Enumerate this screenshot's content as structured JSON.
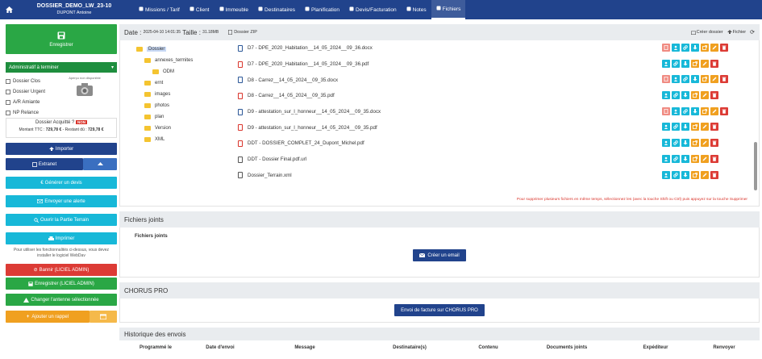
{
  "header": {
    "title": "DOSSIER_DEMO_LW_23-10",
    "subtitle": "DUPONT Antoine",
    "nav": [
      {
        "label": "Missions / Tarif",
        "icon": "grid-icon"
      },
      {
        "label": "Client",
        "icon": "user-icon"
      },
      {
        "label": "Immeuble",
        "icon": "home-icon"
      },
      {
        "label": "Destinataires",
        "icon": "users-icon"
      },
      {
        "label": "Planification",
        "icon": "calendar-icon"
      },
      {
        "label": "Devis/Facturation",
        "icon": "invoice-icon"
      },
      {
        "label": "Notes",
        "icon": "edit-icon"
      },
      {
        "label": "Fichiers",
        "icon": "file-icon"
      }
    ]
  },
  "left": {
    "save_label": "Enregistrer",
    "status_select": "Administratif à terminer",
    "checkboxes": [
      "Dossier Clos",
      "Dossier Urgent",
      "A/R Amiante",
      "NP Relance"
    ],
    "photo_label": "Aperçu non disponible",
    "acquitte_label": "Dossier Acquitté ?",
    "acquitte_value": "NON",
    "montant_label": "Montant TTC :",
    "montant_value": "729,78 €",
    "restant_label": " - Restant dû :",
    "restant_value": "729,78 €",
    "import_label": "Importer",
    "extranet_label": "Extranet",
    "devis_label": "Générer un devis",
    "alerte_label": "Envoyer une alerte",
    "terrain_label": "Ouvrir la Partie Terrain",
    "imprimer_label": "Imprimer",
    "note_line1": "Pour utiliser les fonctionnalités ci-dessus, vous devez",
    "note_line2": "installer le logiciel WebDav",
    "bannir_label": "Bannir (LICIEL ADMIN)",
    "enreg_admin_label": "Enregistrer (LICIEL ADMIN)",
    "antenne_label": "Changer l'antenne sélectionnée",
    "rappel_label": "Ajouter un rappel"
  },
  "files": {
    "date_label": "Date :",
    "date_value": "2025-04-10 14:01:35",
    "size_label": "Taille :",
    "size_value": "31.18MB",
    "zip_label": "Dossier ZIP",
    "create_folder_label": "Créer dossier",
    "file_label": "Fichier",
    "tree": [
      {
        "label": "Dossier",
        "level": 0,
        "selected": true
      },
      {
        "label": "annexes_termites",
        "level": 1
      },
      {
        "label": "ODM",
        "level": 2
      },
      {
        "label": "ernt",
        "level": 1
      },
      {
        "label": "images",
        "level": 1
      },
      {
        "label": "photos",
        "level": 1
      },
      {
        "label": "plan",
        "level": 1
      },
      {
        "label": "Version",
        "level": 1
      },
      {
        "label": "XML",
        "level": 1
      }
    ],
    "items": [
      {
        "name": "D7 - DPE_2020_Habitation__14_05_2024__09_36.docx",
        "type": "doc",
        "pdf": true
      },
      {
        "name": "D7 - DPE_2020_Habitation__14_05_2024__09_36.pdf",
        "type": "pdf",
        "pdf": false
      },
      {
        "name": "D8 - Carrez__14_05_2024__09_35.docx",
        "type": "doc",
        "pdf": true
      },
      {
        "name": "D8 - Carrez__14_05_2024__09_35.pdf",
        "type": "pdf",
        "pdf": false
      },
      {
        "name": "D9 - attestation_sur_l_honneur__14_05_2024__09_35.docx",
        "type": "doc",
        "pdf": true
      },
      {
        "name": "D9 - attestation_sur_l_honneur__14_05_2024__09_35.pdf",
        "type": "pdf",
        "pdf": false
      },
      {
        "name": "DDT - DOSSIER_COMPLET_24_Dupont_Michel.pdf",
        "type": "pdf",
        "pdf": false
      },
      {
        "name": "DDT - Dossier Final.pdf.url",
        "type": "txt",
        "pdf": false
      },
      {
        "name": "Dossier_Terrain.xml",
        "type": "txt",
        "pdf": false
      }
    ],
    "warning": "Pour supprimer plusieurs fichiers en même temps, sélectionnez les (avec la touche Shift ou Ctrl) puis appuyez sur la touche Supprimer"
  },
  "joints": {
    "title": "Fichiers joints",
    "subtitle": "Fichiers joints",
    "email_label": "Créer un email"
  },
  "chorus": {
    "title": "CHORUS PRO",
    "button_label": "Envoi de facture sur CHORUS PRO"
  },
  "history": {
    "title": "Historique des envois",
    "columns": [
      "Programmé le",
      "Date d'envoi",
      "Message",
      "Destinataire(s)",
      "Contenu",
      "Documents joints",
      "Expéditeur",
      "Renvoyer"
    ]
  }
}
